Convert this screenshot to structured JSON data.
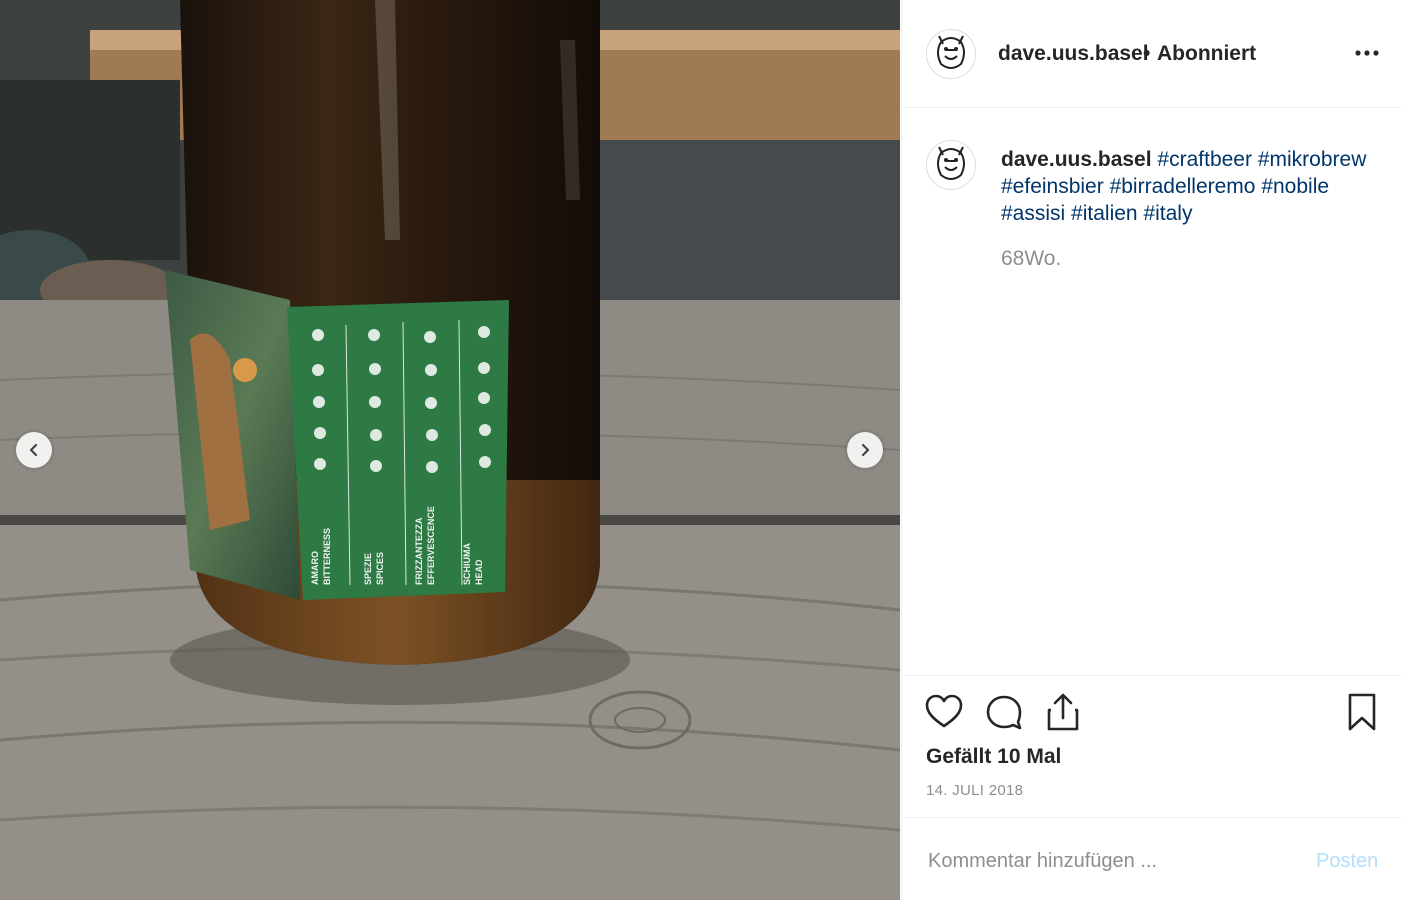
{
  "post": {
    "username": "dave.uus.basel",
    "separator": "•",
    "follow_status": "Abonniert",
    "more_icon": "more-horizontal-icon",
    "caption": {
      "username": "dave.uus.basel",
      "hashtags": [
        "#craftbeer",
        "#mikrobrew",
        "#efeinsbier",
        "#birradelleremo",
        "#nobile",
        "#assisi",
        "#italien",
        "#italy"
      ]
    },
    "time_ago": "68Wo.",
    "likes_text": "Gefällt 10 Mal",
    "date": "14. JULI 2018",
    "comment_placeholder": "Kommentar hinzufügen ...",
    "post_button": "Posten"
  },
  "photo": {
    "label_columns": [
      {
        "line1": "AMARO",
        "line2": "BITTERNESS"
      },
      {
        "line1": "SPEZIE",
        "line2": "SPICES"
      },
      {
        "line1": "FRIZZANTEZZA",
        "line2": "EFFERVESCENCE"
      },
      {
        "line1": "SCHIUMA",
        "line2": "HEAD"
      }
    ]
  },
  "colors": {
    "label_green": "#2d7a45",
    "hashtag": "#003569",
    "post_disabled": "#b2dffc"
  }
}
